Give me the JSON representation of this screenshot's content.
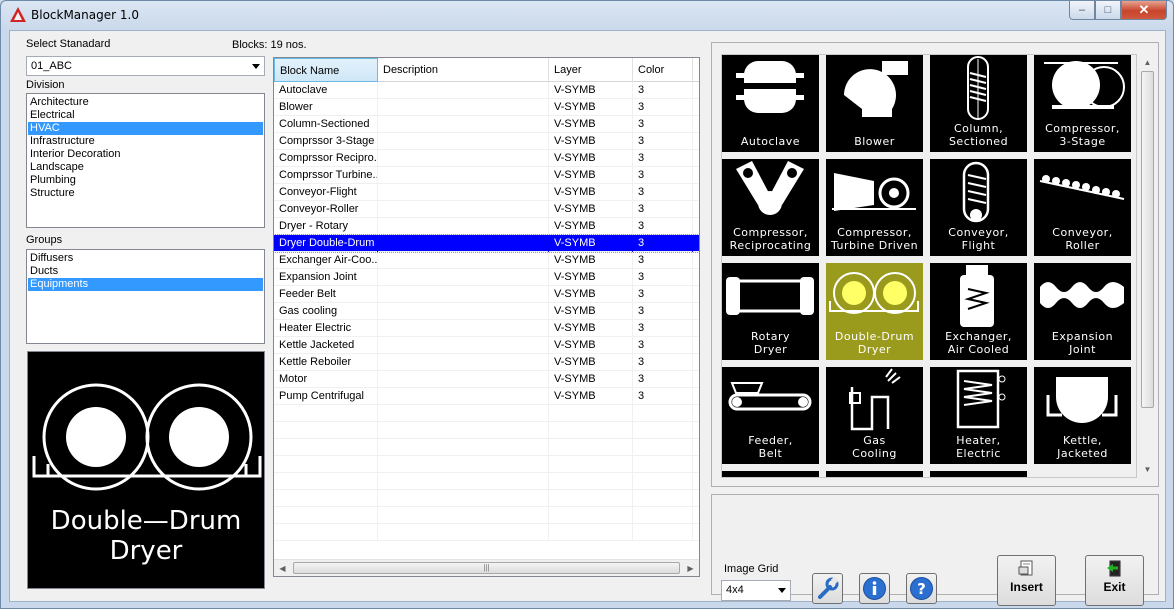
{
  "window": {
    "title": "BlockManager 1.0",
    "min": "–",
    "max": "□",
    "close": "✕"
  },
  "standard": {
    "label": "Select Stanadard",
    "value": "01_ABC"
  },
  "blocks_count": "Blocks: 19 nos.",
  "division": {
    "label": "Division",
    "items": [
      "Architecture",
      "Electrical",
      "HVAC",
      "Infrastructure",
      "Interior Decoration",
      "Landscape",
      "Plumbing",
      "Structure"
    ],
    "selected_index": 2
  },
  "groups": {
    "label": "Groups",
    "items": [
      "Diffusers",
      "Ducts",
      "Equipments"
    ],
    "selected_index": 2
  },
  "preview": {
    "line1": "Double—Drum",
    "line2": "Dryer"
  },
  "table": {
    "columns": [
      "Block Name",
      "Description",
      "Layer",
      "Color"
    ],
    "rows": [
      [
        "Autoclave",
        "",
        "V-SYMB",
        "3"
      ],
      [
        "Blower",
        "",
        "V-SYMB",
        "3"
      ],
      [
        "Column-Sectioned",
        "",
        "V-SYMB",
        "3"
      ],
      [
        "Comprssor 3-Stage",
        "",
        "V-SYMB",
        "3"
      ],
      [
        "Comprssor Recipro...",
        "",
        "V-SYMB",
        "3"
      ],
      [
        "Comprssor Turbine...",
        "",
        "V-SYMB",
        "3"
      ],
      [
        "Conveyor-Flight",
        "",
        "V-SYMB",
        "3"
      ],
      [
        "Conveyor-Roller",
        "",
        "V-SYMB",
        "3"
      ],
      [
        "Dryer - Rotary",
        "",
        "V-SYMB",
        "3"
      ],
      [
        "Dryer Double-Drum",
        "",
        "V-SYMB",
        "3"
      ],
      [
        "Exchanger Air-Coo...",
        "",
        "V-SYMB",
        "3"
      ],
      [
        "Expansion Joint",
        "",
        "V-SYMB",
        "3"
      ],
      [
        "Feeder Belt",
        "",
        "V-SYMB",
        "3"
      ],
      [
        "Gas cooling",
        "",
        "V-SYMB",
        "3"
      ],
      [
        "Heater Electric",
        "",
        "V-SYMB",
        "3"
      ],
      [
        "Kettle Jacketed",
        "",
        "V-SYMB",
        "3"
      ],
      [
        "Kettle Reboiler",
        "",
        "V-SYMB",
        "3"
      ],
      [
        "Motor",
        "",
        "V-SYMB",
        "3"
      ],
      [
        "Pump Centrifugal",
        "",
        "V-SYMB",
        "3"
      ]
    ],
    "selected_row": 9,
    "scroll_grip": "|||"
  },
  "gallery": {
    "tiles": [
      {
        "l1": "Autoclave",
        "l2": "",
        "icon": "autoclave"
      },
      {
        "l1": "Blower",
        "l2": "",
        "icon": "blower"
      },
      {
        "l1": "Column,",
        "l2": "Sectioned",
        "icon": "column"
      },
      {
        "l1": "Compressor,",
        "l2": "3-Stage",
        "icon": "compressor-3stage"
      },
      {
        "l1": "Compressor,",
        "l2": "Reciprocating",
        "icon": "compressor-recip"
      },
      {
        "l1": "Compressor,",
        "l2": "Turbine Driven",
        "icon": "compressor-turbine"
      },
      {
        "l1": "Conveyor,",
        "l2": "Flight",
        "icon": "conveyor-flight"
      },
      {
        "l1": "Conveyor,",
        "l2": "Roller",
        "icon": "conveyor-roller"
      },
      {
        "l1": "Rotary",
        "l2": "Dryer",
        "icon": "rotary-dryer"
      },
      {
        "l1": "Double-Drum",
        "l2": "Dryer",
        "icon": "double-drum"
      },
      {
        "l1": "Exchanger,",
        "l2": "Air Cooled",
        "icon": "exchanger"
      },
      {
        "l1": "Expansion",
        "l2": "Joint",
        "icon": "expansion"
      },
      {
        "l1": "Feeder,",
        "l2": "Belt",
        "icon": "feeder"
      },
      {
        "l1": "Gas",
        "l2": "Cooling",
        "icon": "gas-cooling"
      },
      {
        "l1": "Heater,",
        "l2": "Electric",
        "icon": "heater"
      },
      {
        "l1": "Kettle,",
        "l2": "Jacketed",
        "icon": "kettle"
      },
      {
        "l1": "",
        "l2": "",
        "icon": "partial"
      },
      {
        "l1": "",
        "l2": "",
        "icon": "partial"
      },
      {
        "l1": "",
        "l2": "",
        "icon": "partial"
      }
    ],
    "selected_index": 9
  },
  "image_grid": {
    "label": "Image Grid",
    "value": "4x4"
  },
  "buttons": {
    "insert": "Insert",
    "exit": "Exit"
  },
  "colors": {
    "selection_blue": "#0000ff",
    "list_highlight": "#3399ff",
    "tile_selected": "#9a9a1c"
  }
}
